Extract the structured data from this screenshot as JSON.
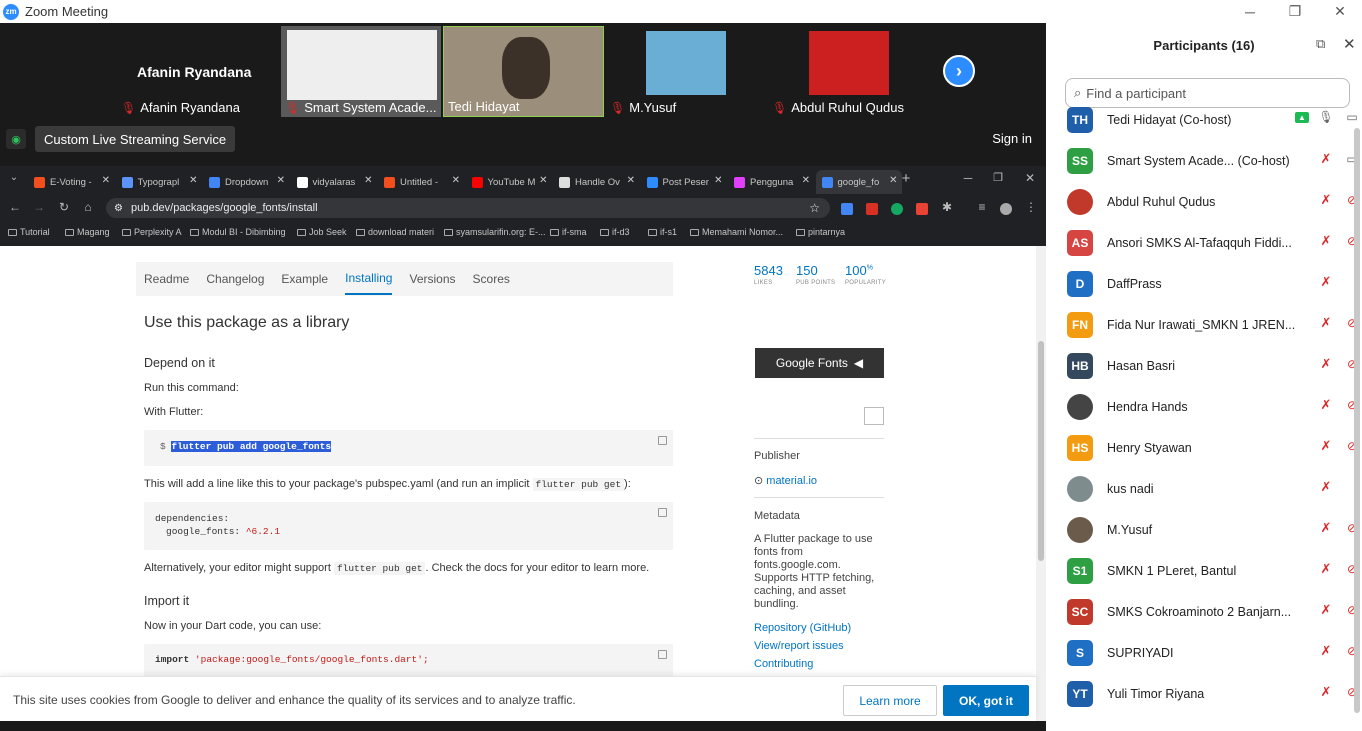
{
  "window": {
    "title": "Zoom Meeting",
    "logo": "zm",
    "min": "─",
    "max": "❐",
    "close": "✕"
  },
  "gallery": {
    "self_name": "Afanin Ryandana",
    "tiles": [
      {
        "name": "Afanin Ryandana",
        "muted": true
      },
      {
        "name": "Smart System Acade...",
        "muted": true
      },
      {
        "name": "Tedi Hidayat",
        "muted": false
      },
      {
        "name": "M.Yusuf",
        "muted": true
      },
      {
        "name": "Abdul Ruhul Qudus",
        "muted": true
      }
    ],
    "live_label": "Custom Live Streaming Service",
    "sign_in": "Sign in"
  },
  "browser": {
    "tabs": [
      {
        "label": "E-Voting -",
        "color": "#f24e1e"
      },
      {
        "label": "Typograpl",
        "color": "#5c93ff"
      },
      {
        "label": "Dropdown",
        "color": "#4285f4"
      },
      {
        "label": "vidyalaras",
        "color": "#ffffff"
      },
      {
        "label": "Untitled -",
        "color": "#f24e1e"
      },
      {
        "label": "YouTube M",
        "color": "#ff0000"
      },
      {
        "label": "Handle Ov",
        "color": "#dddddd"
      },
      {
        "label": "Post Peser",
        "color": "#2d8cff"
      },
      {
        "label": "Pengguna",
        "color": "#e040fb"
      },
      {
        "label": "google_fo",
        "color": "#4285f4"
      }
    ],
    "url": "pub.dev/packages/google_fonts/install",
    "bookmarks": [
      "Tutorial",
      "Magang",
      "Perplexity A",
      "Modul BI - Dibimbing",
      "Job Seek",
      "download materi",
      "syamsularifin.org: E-...",
      "if-sma",
      "if-d3",
      "if-s1",
      "Memahami Nomor...",
      "pintarnya"
    ]
  },
  "pubdev": {
    "tabs": [
      "Readme",
      "Changelog",
      "Example",
      "Installing",
      "Versions",
      "Scores"
    ],
    "active_tab": "Installing",
    "title": "Use this package as a library",
    "depend_heading": "Depend on it",
    "run_cmd": "Run this command:",
    "with_flutter": "With Flutter:",
    "prompt": "$",
    "command": "flutter pub add google_fonts",
    "line_text_1": "This will add a line like this to your package's pubspec.yaml (and run an implicit",
    "line_code": "flutter pub get",
    "line_text_2": "):",
    "dep_line1": "dependencies:",
    "dep_key": "google_fonts:",
    "dep_ver": "^6.2.1",
    "alt_1": "Alternatively, your editor might support",
    "alt_code": "flutter pub get",
    "alt_2": ". Check the docs for your editor to learn more.",
    "import_heading": "Import it",
    "import_text": "Now in your Dart code, you can use:",
    "import_kw": "import",
    "import_str": "'package:google_fonts/google_fonts.dart';",
    "stats": [
      {
        "value": "5843",
        "label": "LIKES"
      },
      {
        "value": "150",
        "label": "PUB POINTS"
      },
      {
        "value": "100",
        "suffix": "%",
        "label": "POPULARITY"
      }
    ],
    "logo_text": "Google Fonts",
    "publisher_h": "Publisher",
    "publisher": "material.io",
    "metadata_h": "Metadata",
    "metadata": "A Flutter package to use fonts from fonts.google.com. Supports HTTP fetching, caching, and asset bundling.",
    "links": [
      "Repository (GitHub)",
      "View/report issues",
      "Contributing"
    ]
  },
  "cookie": {
    "text": "This site uses cookies from Google to deliver and enhance the quality of its services and to analyze traffic.",
    "learn": "Learn more",
    "ok": "OK, got it"
  },
  "participants": {
    "title": "Participants (16)",
    "search_placeholder": "Find a participant",
    "list": [
      {
        "initials": "TH",
        "name": "Tedi Hidayat (Co-host)",
        "color": "#1f5ea8",
        "mic": "on",
        "cam": "on",
        "share": true
      },
      {
        "initials": "SS",
        "name": "Smart System Acade...  (Co-host)",
        "color": "#2ea043",
        "mic": "off",
        "cam": "on"
      },
      {
        "initials": "",
        "name": "Abdul Ruhul Qudus",
        "color": "#c0392b",
        "mic": "off",
        "cam": "off",
        "photo": true
      },
      {
        "initials": "AS",
        "name": "Ansori SMKS Al-Tafaqquh Fiddi...",
        "color": "#d64541",
        "mic": "off",
        "cam": "off"
      },
      {
        "initials": "D",
        "name": "DaffPrass",
        "color": "#1f6fc5",
        "mic": "off",
        "cam": "none"
      },
      {
        "initials": "FN",
        "name": "Fida Nur Irawati_SMKN 1 JREN...",
        "color": "#f39c12",
        "mic": "off",
        "cam": "off"
      },
      {
        "initials": "HB",
        "name": "Hasan Basri",
        "color": "#34495e",
        "mic": "off",
        "cam": "off"
      },
      {
        "initials": "",
        "name": "Hendra Hands",
        "color": "#444444",
        "mic": "off",
        "cam": "off",
        "photo": true
      },
      {
        "initials": "HS",
        "name": "Henry Styawan",
        "color": "#f39c12",
        "mic": "off",
        "cam": "off"
      },
      {
        "initials": "",
        "name": "kus nadi",
        "color": "#7f8c8d",
        "mic": "off",
        "cam": "none",
        "photo": true
      },
      {
        "initials": "",
        "name": "M.Yusuf",
        "color": "#6b5b4b",
        "mic": "off",
        "cam": "off",
        "photo": true
      },
      {
        "initials": "S1",
        "name": "SMKN 1 PLeret, Bantul",
        "color": "#2ea043",
        "mic": "off",
        "cam": "off"
      },
      {
        "initials": "SC",
        "name": "SMKS Cokroaminoto 2 Banjarn...",
        "color": "#c0392b",
        "mic": "off",
        "cam": "off"
      },
      {
        "initials": "S",
        "name": "SUPRIYADI",
        "color": "#1f6fc5",
        "mic": "off",
        "cam": "off"
      },
      {
        "initials": "YT",
        "name": "Yuli Timor Riyana",
        "color": "#1f5ea8",
        "mic": "off",
        "cam": "off"
      }
    ]
  }
}
